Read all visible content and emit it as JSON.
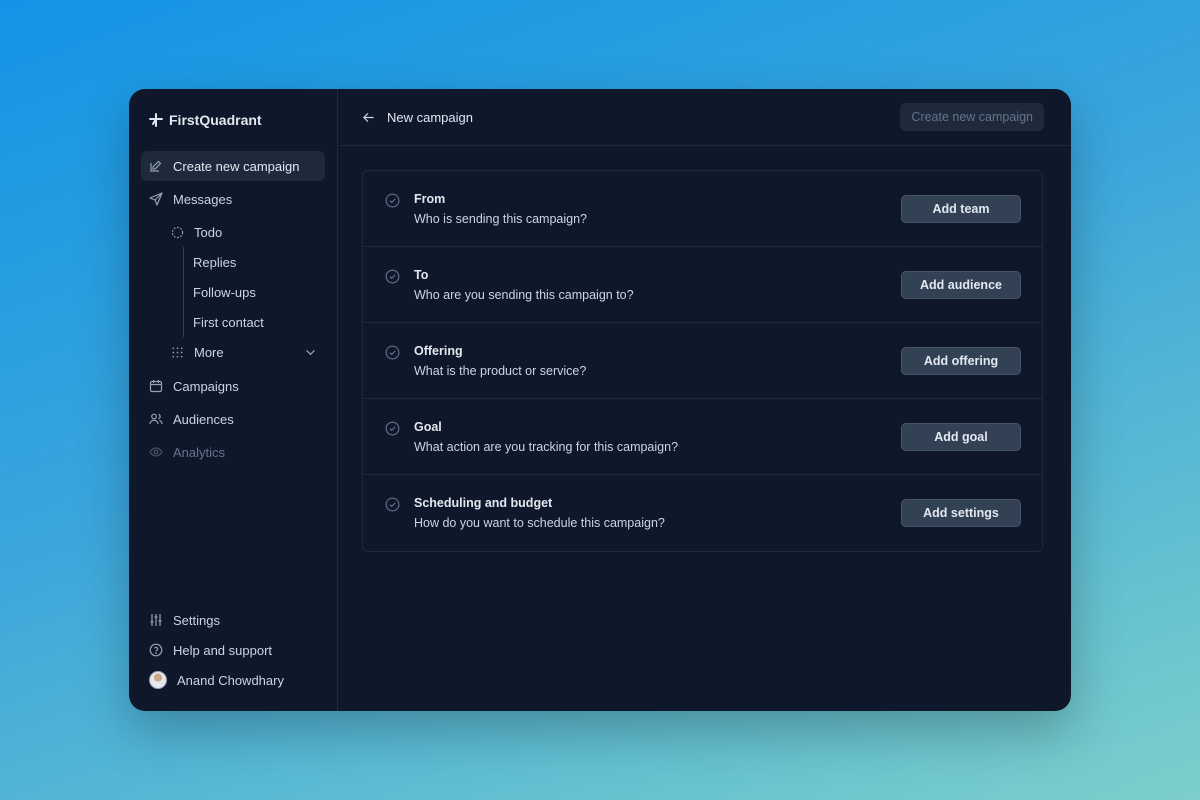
{
  "brand": {
    "name": "FirstQuadrant"
  },
  "sidebar": {
    "create_campaign": "Create new campaign",
    "messages": "Messages",
    "todo": "Todo",
    "replies": "Replies",
    "followups": "Follow-ups",
    "first_contact": "First contact",
    "more": "More",
    "campaigns": "Campaigns",
    "audiences": "Audiences",
    "analytics": "Analytics",
    "settings": "Settings",
    "help": "Help and support",
    "user_name": "Anand Chowdhary"
  },
  "header": {
    "title": "New campaign",
    "create_button": "Create new campaign"
  },
  "steps": [
    {
      "label": "From",
      "description": "Who is sending this campaign?",
      "button": "Add team"
    },
    {
      "label": "To",
      "description": "Who are you sending this campaign to?",
      "button": "Add audience"
    },
    {
      "label": "Offering",
      "description": "What is the product or service?",
      "button": "Add offering"
    },
    {
      "label": "Goal",
      "description": "What action are you tracking for this campaign?",
      "button": "Add goal"
    },
    {
      "label": "Scheduling and budget",
      "description": "How do you want to schedule this campaign?",
      "button": "Add settings"
    }
  ],
  "icons": {
    "brand": "plus-logo-icon",
    "create": "edit-icon",
    "messages": "send-icon",
    "todo": "dashed-circle-icon",
    "more": "grid-dots-icon",
    "chevron": "chevron-down-icon",
    "campaigns": "calendar-icon",
    "audiences": "users-icon",
    "analytics": "eye-icon",
    "settings": "sliders-icon",
    "help": "help-circle-icon",
    "back": "arrow-left-icon",
    "step": "check-circle-icon"
  }
}
